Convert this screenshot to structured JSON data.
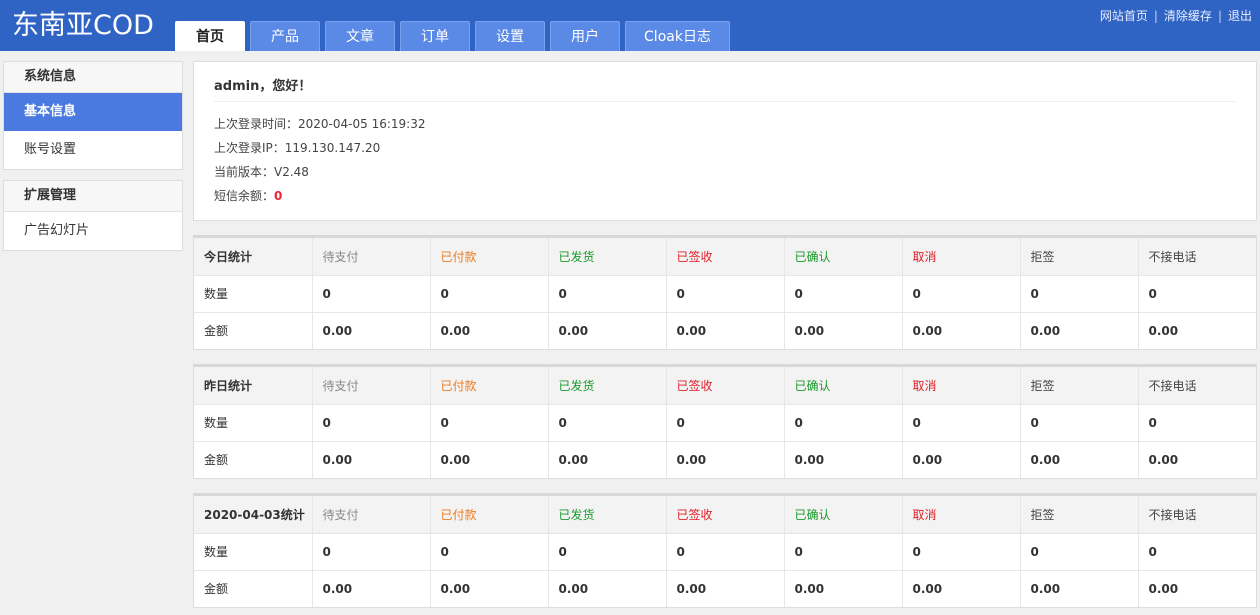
{
  "header": {
    "logo": "东南亚COD",
    "tabs": [
      {
        "label": "首页",
        "active": true
      },
      {
        "label": "产品"
      },
      {
        "label": "文章"
      },
      {
        "label": "订单"
      },
      {
        "label": "设置"
      },
      {
        "label": "用户"
      },
      {
        "label": "Cloak日志"
      }
    ],
    "links": [
      "网站首页",
      "清除缓存",
      "退出"
    ],
    "separator": "|"
  },
  "sidebar": {
    "groups": [
      {
        "title": "系统信息",
        "items": [
          {
            "label": "基本信息",
            "active": true
          },
          {
            "label": "账号设置"
          }
        ]
      },
      {
        "title": "扩展管理",
        "items": [
          {
            "label": "广告幻灯片"
          }
        ]
      }
    ]
  },
  "info": {
    "greeting": "admin，您好！",
    "last_login_time_label": "上次登录时间：",
    "last_login_time": "2020-04-05 16:19:32",
    "last_login_ip_label": "上次登录IP：",
    "last_login_ip": "119.130.147.20",
    "version_label": "当前版本：",
    "version": "V2.48",
    "sms_label": "短信余额：",
    "sms_balance": "0"
  },
  "stat_columns": [
    "待支付",
    "已付款",
    "已发货",
    "已签收",
    "已确认",
    "取消",
    "拒签",
    "不接电话"
  ],
  "stat_row_labels": [
    "数量",
    "金额"
  ],
  "stats": [
    {
      "title": "今日统计",
      "count": [
        "0",
        "0",
        "0",
        "0",
        "0",
        "0",
        "0",
        "0"
      ],
      "amount": [
        "0.00",
        "0.00",
        "0.00",
        "0.00",
        "0.00",
        "0.00",
        "0.00",
        "0.00"
      ]
    },
    {
      "title": "昨日统计",
      "count": [
        "0",
        "0",
        "0",
        "0",
        "0",
        "0",
        "0",
        "0"
      ],
      "amount": [
        "0.00",
        "0.00",
        "0.00",
        "0.00",
        "0.00",
        "0.00",
        "0.00",
        "0.00"
      ]
    },
    {
      "title": "2020-04-03统计",
      "count": [
        "0",
        "0",
        "0",
        "0",
        "0",
        "0",
        "0",
        "0"
      ],
      "amount": [
        "0.00",
        "0.00",
        "0.00",
        "0.00",
        "0.00",
        "0.00",
        "0.00",
        "0.00"
      ]
    }
  ],
  "colors": {
    "header": "#2f63c4",
    "active": "#4a7ae0",
    "orange": "#f07a1a",
    "green": "#1a9a2a",
    "red": "#e0202a"
  }
}
